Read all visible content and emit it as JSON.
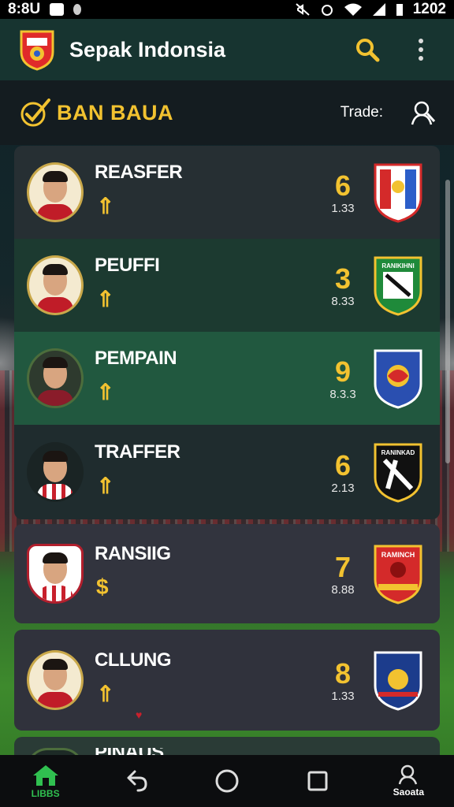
{
  "status_bar": {
    "time": "8:8U",
    "right_text": "1202"
  },
  "app_bar": {
    "title": "Sepak Indonsia",
    "icons": [
      "club-crest-icon",
      "search-icon",
      "more-vert-icon"
    ]
  },
  "section": {
    "title": "BAN BAUA",
    "aside_label": "Trade:",
    "icons": [
      "check-badge-icon",
      "user-search-icon"
    ]
  },
  "players": [
    {
      "name": "REASFER",
      "badge": "⇑",
      "stat": "6",
      "sub": "1.33",
      "accent": "#2b5ec9"
    },
    {
      "name": "PEUFFI",
      "badge": "⇑",
      "stat": "3",
      "sub": "8.33",
      "accent": "#1f8a3a"
    },
    {
      "name": "PEMPAIN",
      "badge": "⇑",
      "stat": "9",
      "sub": "8.3.3",
      "accent": "#2a4fb0"
    },
    {
      "name": "TRAFFER",
      "badge": "⇑",
      "stat": "6",
      "sub": "2.13",
      "accent": "#111111"
    },
    {
      "name": "RANSIIG",
      "badge": "$",
      "stat": "7",
      "sub": "8.88",
      "accent": "#d42a2a"
    },
    {
      "name": "CLLUNG",
      "badge": "⇑",
      "stat": "8",
      "sub": "1.33",
      "accent": "#1c3c8c"
    },
    {
      "name": "PINAUS",
      "badge": "",
      "stat": "",
      "sub": "",
      "accent": "#2a3b36"
    }
  ],
  "club_texts": {
    "c1": "RANIKIHNI",
    "c3": "RANINKAD",
    "c4": "RAMINCH"
  },
  "bottom_nav": {
    "home_label": "LIBBS",
    "profile_label": "Saoata"
  },
  "colors": {
    "accent_gold": "#f2c230",
    "app_bar": "#173430",
    "nav_green": "#30c050"
  }
}
